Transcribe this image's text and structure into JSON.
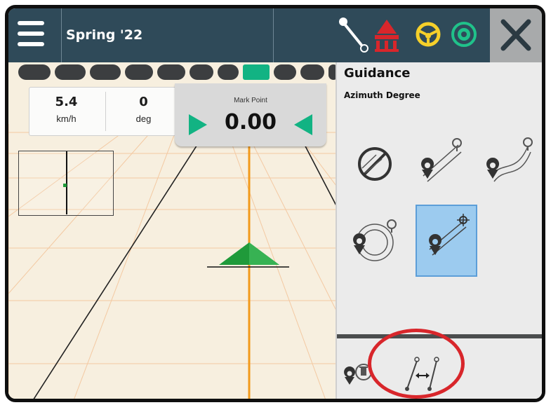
{
  "topbar": {
    "title": "Spring '22",
    "icons": [
      "menu-icon",
      "guideline-icon",
      "field-boundary-icon",
      "steering-wheel-icon",
      "gnss-icon",
      "close-icon"
    ]
  },
  "lightbar": {
    "led_count": 11,
    "active_led": 7,
    "colors": {
      "off": "#3c3e40",
      "on": "#12b383"
    }
  },
  "stats": [
    {
      "value": "5.4",
      "unit": "km/h"
    },
    {
      "value": "0",
      "unit": "deg"
    }
  ],
  "mark_point": {
    "label": "Mark Point",
    "value": "0.00"
  },
  "panel": {
    "title": "Guidance",
    "subtitle": "Azimuth Degree",
    "modes": [
      {
        "name": "no-guidance",
        "icon": "no-guidance-icon",
        "selected": false
      },
      {
        "name": "straight-ab",
        "icon": "straight-ab-icon",
        "selected": false
      },
      {
        "name": "curved-ab",
        "icon": "curved-ab-icon",
        "selected": false
      },
      {
        "name": "circle-pivot",
        "icon": "circle-pivot-icon",
        "selected": false
      },
      {
        "name": "azimuth-degree",
        "icon": "azimuth-icon",
        "selected": true
      }
    ],
    "bottom_buttons": [
      "delete-guideline-icon",
      "shift-guideline-icon"
    ]
  },
  "colors": {
    "topbar": "#2f4a59",
    "map_background": "#f7efdf",
    "guideline": "#f29a1b",
    "vehicle": "#1f9a3a",
    "selection": "#9ccbef",
    "highlight": "#d8262b"
  }
}
